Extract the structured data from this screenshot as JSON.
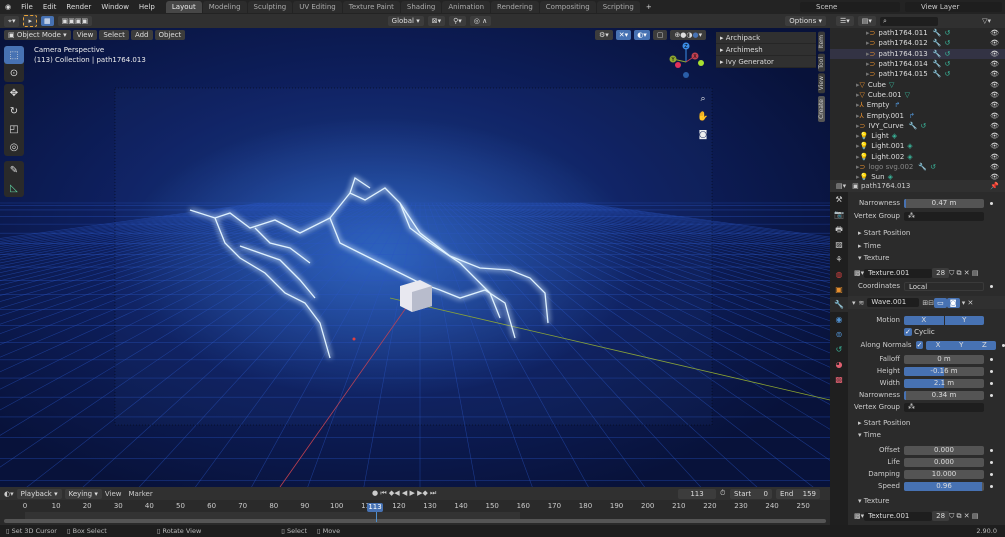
{
  "menu": {
    "items": [
      "File",
      "Edit",
      "Render",
      "Window",
      "Help"
    ]
  },
  "workspaces": [
    "Layout",
    "Modeling",
    "Sculpting",
    "UV Editing",
    "Texture Paint",
    "Shading",
    "Animation",
    "Rendering",
    "Compositing",
    "Scripting"
  ],
  "active_workspace": "Layout",
  "scene": "Scene",
  "view_layer": "View Layer",
  "toolbar": {
    "transform": "Global",
    "options": "Options"
  },
  "viewport": {
    "mode": "Object Mode",
    "menus": [
      "View",
      "Select",
      "Add",
      "Object"
    ],
    "overlay_line1": "Camera Perspective",
    "overlay_line2": "(113) Collection | path1764.013",
    "npanel": [
      "Archipack",
      "Archimesh",
      "Ivy Generator"
    ],
    "side_tabs": [
      "Item",
      "Tool",
      "View",
      "Create"
    ],
    "gizmo": {
      "z": "Z",
      "y": "Y",
      "x": "X"
    }
  },
  "outliner": {
    "items": [
      {
        "name": "path1764.011",
        "icon": "curve"
      },
      {
        "name": "path1764.012",
        "icon": "curve"
      },
      {
        "name": "path1764.013",
        "icon": "curve"
      },
      {
        "name": "path1764.014",
        "icon": "curve"
      },
      {
        "name": "path1764.015",
        "icon": "curve"
      },
      {
        "name": "Cube",
        "icon": "mesh"
      },
      {
        "name": "Cube.001",
        "icon": "mesh"
      },
      {
        "name": "Empty",
        "icon": "empty"
      },
      {
        "name": "Empty.001",
        "icon": "empty"
      },
      {
        "name": "IVY_Curve",
        "icon": "curve"
      },
      {
        "name": "Light",
        "icon": "light"
      },
      {
        "name": "Light.001",
        "icon": "light"
      },
      {
        "name": "Light.002",
        "icon": "light"
      },
      {
        "name": "logo svg.002",
        "icon": "curve"
      },
      {
        "name": "Sun",
        "icon": "light"
      }
    ]
  },
  "properties": {
    "object": "path1764.013",
    "wave1": {
      "narrowness": "0.47 m",
      "vertex_group": "Vertex Group",
      "start_position": "Start Position",
      "time": "Time",
      "texture": "Texture",
      "texture_name": "Texture.001",
      "users": "28",
      "coordinates_label": "Coordinates",
      "coordinates": "Local"
    },
    "modifier": {
      "name": "Wave.001",
      "motion_label": "Motion",
      "motion_x": "X",
      "motion_y": "Y",
      "cyclic": "Cyclic",
      "along_normals": "Along Normals",
      "ax": "X",
      "ay": "Y",
      "az": "Z",
      "falloff_label": "Falloff",
      "falloff": "0 m",
      "height_label": "Height",
      "height": "-0.16 m",
      "width_label": "Width",
      "width": "2.1 m",
      "narrowness_label": "Narrowness",
      "narrowness": "0.34 m",
      "vertex_group": "Vertex Group",
      "start_position": "Start Position",
      "time": "Time",
      "offset_label": "Offset",
      "offset": "0.000",
      "life_label": "Life",
      "life": "0.000",
      "damping_label": "Damping",
      "damping": "10.000",
      "speed_label": "Speed",
      "speed": "0.96",
      "texture": "Texture",
      "texture_name": "Texture.001",
      "users": "28"
    }
  },
  "timeline": {
    "menus": [
      "Playback",
      "Keying",
      "View",
      "Marker"
    ],
    "current": "113",
    "start_label": "Start",
    "start": "0",
    "end_label": "End",
    "end": "159",
    "ticks": [
      "0",
      "10",
      "20",
      "30",
      "40",
      "50",
      "60",
      "70",
      "80",
      "90",
      "100",
      "110",
      "120",
      "130",
      "140",
      "150",
      "160",
      "170",
      "180",
      "190",
      "200",
      "210",
      "220",
      "230",
      "240",
      "250"
    ]
  },
  "status": {
    "items": [
      "Set 3D Cursor",
      "Box Select",
      "Rotate View",
      "Select",
      "Move"
    ],
    "version": "2.90.0"
  }
}
